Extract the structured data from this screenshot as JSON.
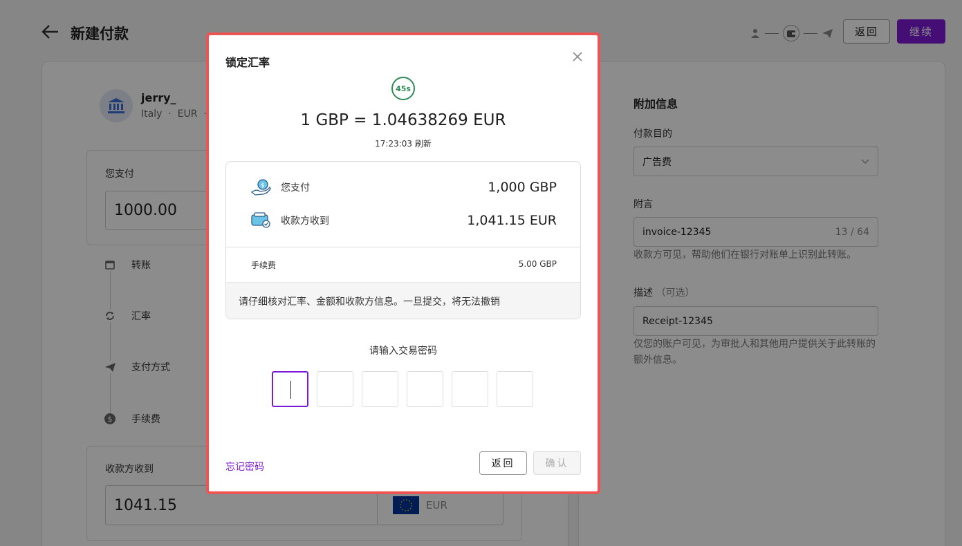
{
  "header": {
    "title": "新建付款",
    "back_label": "返回",
    "continue_label": "继续"
  },
  "payee": {
    "name": "jerry_",
    "country": "Italy",
    "currency": "EUR"
  },
  "payment": {
    "you_pay_label": "您支付",
    "you_pay_value": "1000.00"
  },
  "timeline": [
    "转账",
    "汇率",
    "支付方式",
    "手续费"
  ],
  "receive": {
    "label": "收款方收到",
    "value": "1041.15",
    "currency": "EUR"
  },
  "extra": {
    "title": "附加信息",
    "purpose_label": "付款目的",
    "purpose_value": "广告费",
    "memo_label": "附言",
    "memo_value": "invoice-12345",
    "memo_count": "13 / 64",
    "memo_help": "收款方可见，帮助他们在银行对账单上识别此转账。",
    "desc_label": "描述",
    "desc_optional": "（可选）",
    "desc_value": "Receipt-12345",
    "desc_help": "仅您的账户可见，为审批人和其他用户提供关于此转账的额外信息。"
  },
  "modal": {
    "title": "锁定汇率",
    "timer": "45s",
    "rate": "1 GBP = 1.04638269 EUR",
    "refresh": "17:23:03 刷新",
    "you_pay_label": "您支付",
    "you_pay_value": "1,000 GBP",
    "recipient_label": "收款方收到",
    "recipient_value": "1,041.15 EUR",
    "fee_label": "手续费",
    "fee_value": "5.00 GBP",
    "notice": "请仔细核对汇率、金额和收款方信息。一旦提交，将无法撤销",
    "password_label": "请输入交易密码",
    "forgot_label": "忘记密码",
    "back_label": "返回",
    "confirm_label": "确认"
  },
  "colors": {
    "brand": "#7c1ad6",
    "timer": "#2e8b57",
    "highlight": "#ee5454"
  }
}
